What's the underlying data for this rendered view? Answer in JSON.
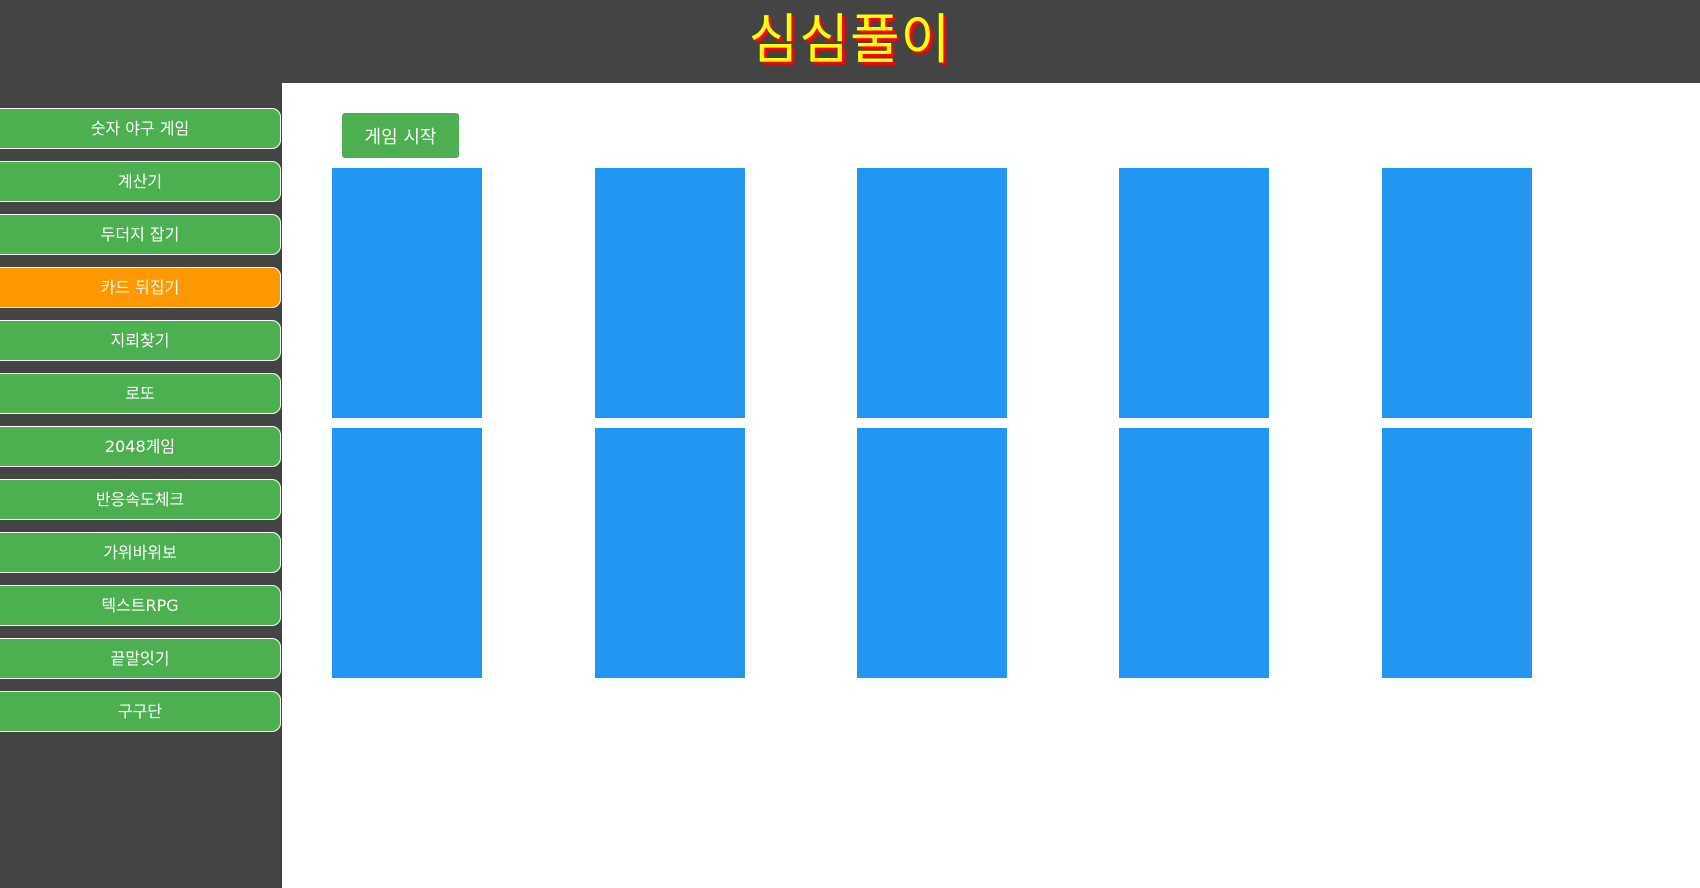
{
  "header": {
    "title": "심심풀이"
  },
  "sidebar": {
    "items": [
      {
        "label": "숫자 야구 게임",
        "active": false
      },
      {
        "label": "계산기",
        "active": false
      },
      {
        "label": "두더지 잡기",
        "active": false
      },
      {
        "label": "카드 뒤집기",
        "active": true
      },
      {
        "label": "지뢰찾기",
        "active": false
      },
      {
        "label": "로또",
        "active": false
      },
      {
        "label": "2048게임",
        "active": false
      },
      {
        "label": "반응속도체크",
        "active": false
      },
      {
        "label": "가위바위보",
        "active": false
      },
      {
        "label": "텍스트RPG",
        "active": false
      },
      {
        "label": "끝말잇기",
        "active": false
      },
      {
        "label": "구구단",
        "active": false
      }
    ]
  },
  "main": {
    "start_button_label": "게임 시작",
    "cards": {
      "rows": 2,
      "columns": 5,
      "state": "face-down"
    }
  },
  "colors": {
    "background": "#444444",
    "title_text": "#ffff00",
    "title_shadow": "#ff0000",
    "menu_item": "#4caf50",
    "menu_item_active": "#ff9800",
    "card_back": "#2196f3",
    "content_background": "#ffffff"
  }
}
